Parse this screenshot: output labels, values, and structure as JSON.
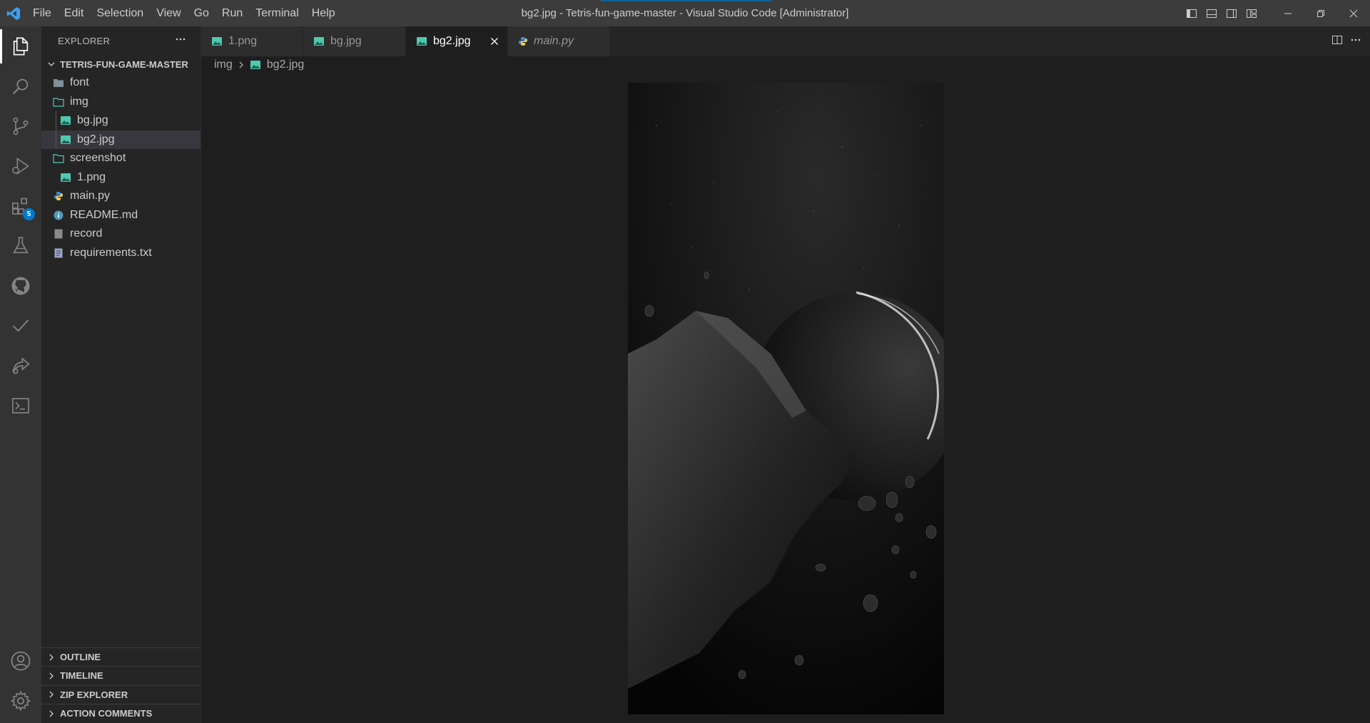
{
  "titlebar": {
    "title": "bg2.jpg - Tetris-fun-game-master - Visual Studio Code [Administrator]",
    "menu": [
      "File",
      "Edit",
      "Selection",
      "View",
      "Go",
      "Run",
      "Terminal",
      "Help"
    ]
  },
  "activity_bar": {
    "items": [
      "explorer-icon",
      "search-icon",
      "source-control-icon",
      "run-debug-icon",
      "extensions-icon",
      "testing-icon",
      "github-icon",
      "checkmark-icon",
      "live-share-icon",
      "terminal-icon"
    ],
    "extensions_badge": "5",
    "bottom": [
      "account-icon",
      "settings-gear-icon"
    ]
  },
  "explorer": {
    "title": "EXPLORER",
    "root": "TETRIS-FUN-GAME-MASTER",
    "tree": [
      {
        "label": "font",
        "type": "folder-closed"
      },
      {
        "label": "img",
        "type": "folder-open"
      },
      {
        "label": "bg.jpg",
        "type": "image"
      },
      {
        "label": "bg2.jpg",
        "type": "image"
      },
      {
        "label": "screenshot",
        "type": "folder-open"
      },
      {
        "label": "1.png",
        "type": "image"
      },
      {
        "label": "main.py",
        "type": "python"
      },
      {
        "label": "README.md",
        "type": "info"
      },
      {
        "label": "record",
        "type": "file"
      },
      {
        "label": "requirements.txt",
        "type": "text"
      }
    ],
    "sections": [
      "OUTLINE",
      "TIMELINE",
      "ZIP EXPLORER",
      "ACTION COMMENTS"
    ]
  },
  "tabs": [
    {
      "label": "1.png",
      "active": false
    },
    {
      "label": "bg.jpg",
      "active": false
    },
    {
      "label": "bg2.jpg",
      "active": true
    },
    {
      "label": "main.py",
      "active": false,
      "italic": true
    }
  ],
  "breadcrumb": [
    "img",
    "bg2.jpg"
  ],
  "colors": {
    "titlebar": "#3c3c3c",
    "activity_bar": "#333333",
    "sidebar": "#252526",
    "editor": "#1e1e1e",
    "accent": "#007acc",
    "image_icon": "#4ec9b0"
  }
}
